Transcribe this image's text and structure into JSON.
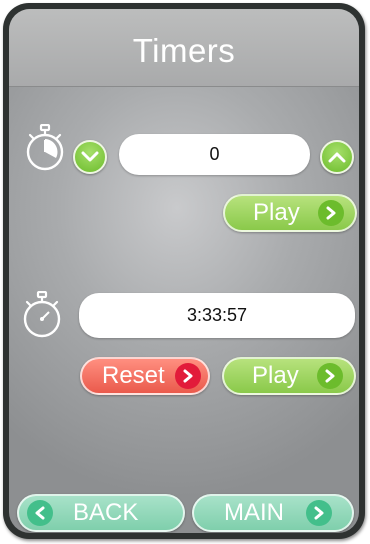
{
  "header": {
    "title": "Timers"
  },
  "timer1": {
    "value": "0",
    "decrease_icon": "chevron-down-icon",
    "increase_icon": "chevron-up-icon",
    "play_label": "Play"
  },
  "timer2": {
    "value": "3:33:57",
    "reset_label": "Reset",
    "play_label": "Play"
  },
  "footer": {
    "back_label": "BACK",
    "main_label": "MAIN"
  },
  "colors": {
    "accent_green": "#8ac94a",
    "reset_red": "#ea5a4c",
    "nav_teal": "#7fcfac"
  }
}
